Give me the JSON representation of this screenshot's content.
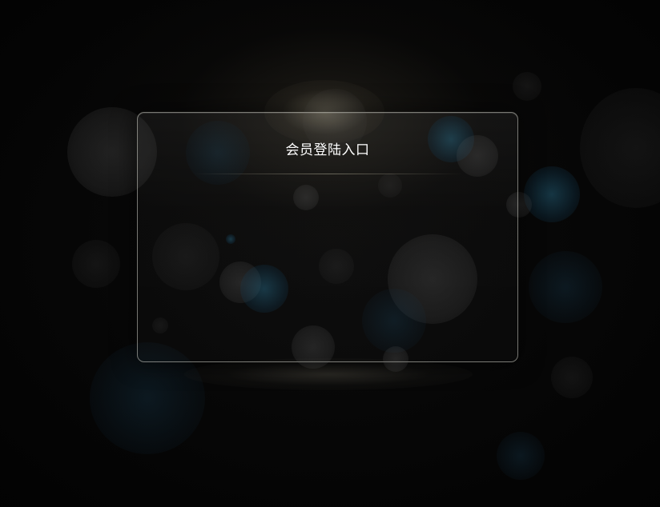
{
  "login_panel": {
    "title": "会员登陆入口"
  },
  "colors": {
    "background": "#000000",
    "panel_border": "#d2d2c8",
    "title_text": "#ffffff",
    "bokeh_blue": "#286e8c",
    "bokeh_gray": "#8c8c8c"
  }
}
